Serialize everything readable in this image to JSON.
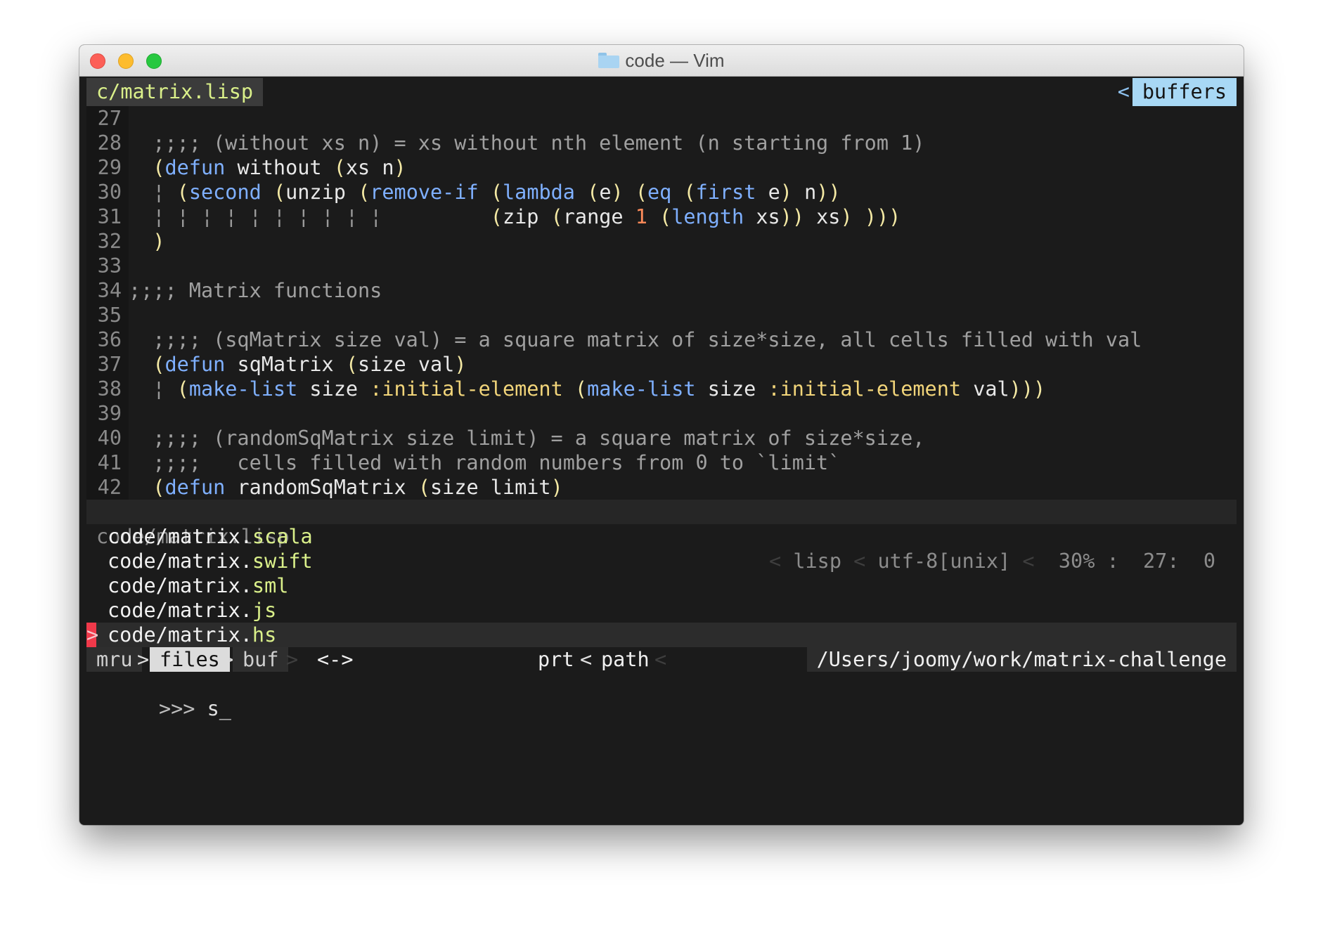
{
  "window": {
    "title": "code — Vim",
    "icons": {
      "close": "close-icon",
      "minimize": "minimize-icon",
      "maximize": "maximize-icon",
      "folder": "folder-icon"
    }
  },
  "tabline": {
    "active_tab": "c/matrix.lisp",
    "right_arrow": "<",
    "right_label": "buffers"
  },
  "editor": {
    "lines": [
      {
        "n": "27",
        "segs": []
      },
      {
        "n": "28",
        "segs": [
          {
            "c": "cm",
            "t": "  ;;;; (without xs n) = xs without nth element (n starting from 1)"
          }
        ]
      },
      {
        "n": "29",
        "segs": [
          {
            "c": "pn",
            "t": "  ("
          },
          {
            "c": "kw",
            "t": "defun"
          },
          {
            "c": "tx",
            "t": " without "
          },
          {
            "c": "pn",
            "t": "("
          },
          {
            "c": "tx",
            "t": "xs n"
          },
          {
            "c": "pn",
            "t": ")"
          }
        ]
      },
      {
        "n": "30",
        "segs": [
          {
            "c": "gd",
            "t": "  ¦ "
          },
          {
            "c": "pn",
            "t": "("
          },
          {
            "c": "kw",
            "t": "second"
          },
          {
            "c": "tx",
            "t": " "
          },
          {
            "c": "pn",
            "t": "("
          },
          {
            "c": "tx",
            "t": "unzip "
          },
          {
            "c": "pn",
            "t": "("
          },
          {
            "c": "kw",
            "t": "remove-if"
          },
          {
            "c": "tx",
            "t": " "
          },
          {
            "c": "pn",
            "t": "("
          },
          {
            "c": "kw",
            "t": "lambda"
          },
          {
            "c": "tx",
            "t": " "
          },
          {
            "c": "pn",
            "t": "("
          },
          {
            "c": "tx",
            "t": "e"
          },
          {
            "c": "pn",
            "t": ")"
          },
          {
            "c": "tx",
            "t": " "
          },
          {
            "c": "pn",
            "t": "("
          },
          {
            "c": "kw",
            "t": "eq"
          },
          {
            "c": "tx",
            "t": " "
          },
          {
            "c": "pn",
            "t": "("
          },
          {
            "c": "kw",
            "t": "first"
          },
          {
            "c": "tx",
            "t": " e"
          },
          {
            "c": "pn",
            "t": ")"
          },
          {
            "c": "tx",
            "t": " n"
          },
          {
            "c": "pn",
            "t": "))"
          }
        ]
      },
      {
        "n": "31",
        "segs": [
          {
            "c": "gd",
            "t": "  ¦ ¦ ¦ ¦ ¦ ¦ ¦ ¦ ¦ ¦         "
          },
          {
            "c": "pn",
            "t": "("
          },
          {
            "c": "tx",
            "t": "zip "
          },
          {
            "c": "pn",
            "t": "("
          },
          {
            "c": "tx",
            "t": "range "
          },
          {
            "c": "nm",
            "t": "1"
          },
          {
            "c": "tx",
            "t": " "
          },
          {
            "c": "pn",
            "t": "("
          },
          {
            "c": "kw",
            "t": "length"
          },
          {
            "c": "tx",
            "t": " xs"
          },
          {
            "c": "pn",
            "t": "))"
          },
          {
            "c": "tx",
            "t": " xs"
          },
          {
            "c": "pn",
            "t": ")"
          },
          {
            "c": "tx",
            "t": " "
          },
          {
            "c": "pn",
            "t": ")))"
          }
        ]
      },
      {
        "n": "32",
        "segs": [
          {
            "c": "pn",
            "t": "  )"
          }
        ]
      },
      {
        "n": "33",
        "segs": []
      },
      {
        "n": "34",
        "segs": [
          {
            "c": "cm",
            "t": ";;;; Matrix functions"
          }
        ]
      },
      {
        "n": "35",
        "segs": []
      },
      {
        "n": "36",
        "segs": [
          {
            "c": "cm",
            "t": "  ;;;; (sqMatrix size val) = a square matrix of size*size, all cells filled with val"
          }
        ]
      },
      {
        "n": "37",
        "segs": [
          {
            "c": "pn",
            "t": "  ("
          },
          {
            "c": "kw",
            "t": "defun"
          },
          {
            "c": "tx",
            "t": " sqMatrix "
          },
          {
            "c": "pn",
            "t": "("
          },
          {
            "c": "tx",
            "t": "size val"
          },
          {
            "c": "pn",
            "t": ")"
          }
        ]
      },
      {
        "n": "38",
        "segs": [
          {
            "c": "gd",
            "t": "  ¦ "
          },
          {
            "c": "pn",
            "t": "("
          },
          {
            "c": "kw",
            "t": "make-list"
          },
          {
            "c": "tx",
            "t": " size "
          },
          {
            "c": "ky",
            "t": ":initial-element"
          },
          {
            "c": "tx",
            "t": " "
          },
          {
            "c": "pn",
            "t": "("
          },
          {
            "c": "kw",
            "t": "make-list"
          },
          {
            "c": "tx",
            "t": " size "
          },
          {
            "c": "ky",
            "t": ":initial-element"
          },
          {
            "c": "tx",
            "t": " val"
          },
          {
            "c": "pn",
            "t": ")))"
          }
        ]
      },
      {
        "n": "39",
        "segs": []
      },
      {
        "n": "40",
        "segs": [
          {
            "c": "cm",
            "t": "  ;;;; (randomSqMatrix size limit) = a square matrix of size*size,"
          }
        ]
      },
      {
        "n": "41",
        "segs": [
          {
            "c": "cm",
            "t": "  ;;;;   cells filled with random numbers from 0 to `limit`"
          }
        ]
      },
      {
        "n": "42",
        "segs": [
          {
            "c": "pn",
            "t": "  ("
          },
          {
            "c": "kw",
            "t": "defun"
          },
          {
            "c": "tx",
            "t": " randomSqMatrix "
          },
          {
            "c": "pn",
            "t": "("
          },
          {
            "c": "tx",
            "t": "size limit"
          },
          {
            "c": "pn",
            "t": ")"
          }
        ]
      }
    ]
  },
  "statusline": {
    "file": "code/matrix.lisp",
    "filetype": "lisp",
    "encoding": "utf-8[unix]",
    "percent": "30%",
    "line": "27",
    "col": "0"
  },
  "results": [
    {
      "stem": "code/matrix.",
      "ext": "scala",
      "selected": false
    },
    {
      "stem": "code/matrix.",
      "ext": "swift",
      "selected": false
    },
    {
      "stem": "code/matrix.",
      "ext": "sml",
      "selected": false
    },
    {
      "stem": "code/matrix.",
      "ext": "js",
      "selected": false
    },
    {
      "stem": "code/matrix.",
      "ext": "hs",
      "selected": true
    }
  ],
  "selection_marker": ">",
  "ctrlp": {
    "mru": "mru",
    "files": "files",
    "buf": "buf",
    "lr": "<->",
    "prt": "prt",
    "path_label": "path",
    "cwd": "/Users/joomy/work/matrix-challenge"
  },
  "cmdline": {
    "prompt": ">>>",
    "input": "s_"
  },
  "colors": {
    "background": "#1b1b1b",
    "comment": "#a0a0a0",
    "keyword": "#7fb0ff",
    "paren": "#f4e9a4",
    "number": "#ff8c5a",
    "key": "#f2d57a",
    "tab_active_fg": "#daf08a",
    "buffers_bg": "#a8d8f5",
    "selection_marker": "#f0394a"
  }
}
